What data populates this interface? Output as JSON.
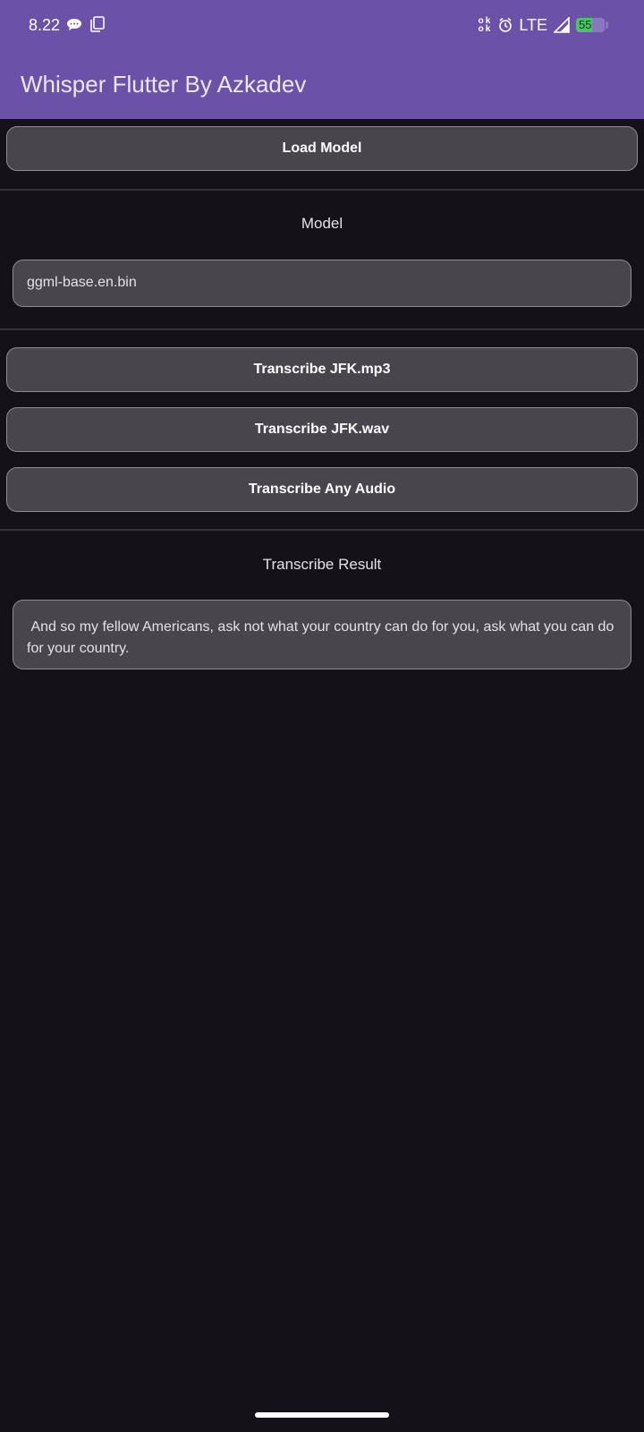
{
  "status_bar": {
    "time": "8.22",
    "network": "LTE",
    "ok_top": "ok",
    "ok_bottom": "ok",
    "battery_level": "55",
    "battery_fraction": 0.55,
    "icons": [
      "chat-icon",
      "copy-icon",
      "ok-icon",
      "alarm-icon",
      "signal-icon",
      "battery-icon"
    ]
  },
  "app_bar": {
    "title": "Whisper Flutter By Azkadev",
    "color": "#6b52a8"
  },
  "buttons": {
    "load_model": "Load Model",
    "transcribe_mp3": "Transcribe JFK.mp3",
    "transcribe_wav": "Transcribe JFK.wav",
    "transcribe_any": "Transcribe Any Audio"
  },
  "model_section": {
    "label": "Model",
    "value": "ggml-base.en.bin"
  },
  "result_section": {
    "label": "Transcribe Result",
    "text": " And so my fellow Americans, ask not what your country can do for you, ask what you can do for your country."
  },
  "colors": {
    "background": "#141218",
    "surface": "#48454d",
    "outline": "#8f8a97",
    "battery_green": "#4cc36b"
  }
}
